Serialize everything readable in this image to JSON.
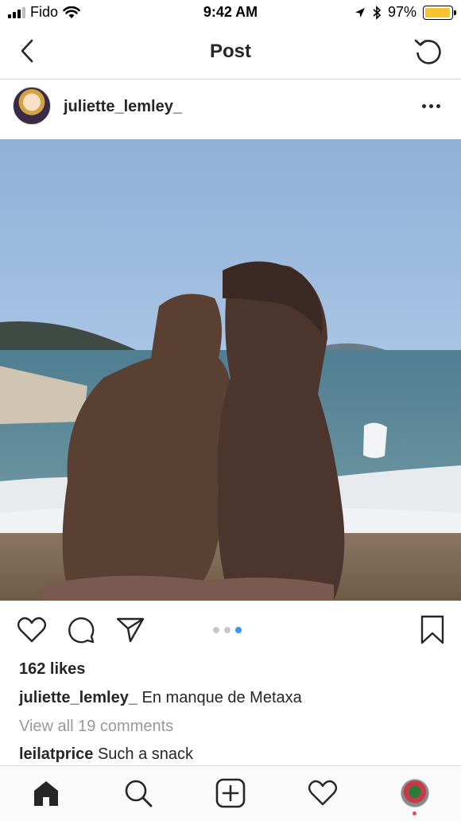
{
  "status_bar": {
    "carrier": "Fido",
    "time": "9:42 AM",
    "battery_percent": "97%",
    "battery_level": 0.97,
    "icons": [
      "signal-icon",
      "wifi-icon",
      "location-arrow-icon",
      "bluetooth-icon",
      "battery-icon"
    ]
  },
  "nav": {
    "title": "Post",
    "back_icon": "chevron-left-icon",
    "refresh_icon": "refresh-icon"
  },
  "post": {
    "username": "juliette_lemley_",
    "more_icon": "more-horizontal-icon",
    "carousel": {
      "count": 3,
      "active_index": 3
    },
    "likes": "162 likes",
    "caption": {
      "username": "juliette_lemley_",
      "text": "En manque de Metaxa"
    },
    "view_all_comments": "View all 19 comments",
    "comments": [
      {
        "username": "leilatprice",
        "text": "Such a snack"
      }
    ]
  },
  "tab_bar": {
    "items": [
      "home-icon",
      "search-icon",
      "add-post-icon",
      "activity-heart-icon",
      "profile-avatar"
    ]
  },
  "colors": {
    "accent": "#3897f0",
    "text": "#262626",
    "muted": "#999999",
    "notification": "#ed4956",
    "battery": "#f5c531"
  }
}
